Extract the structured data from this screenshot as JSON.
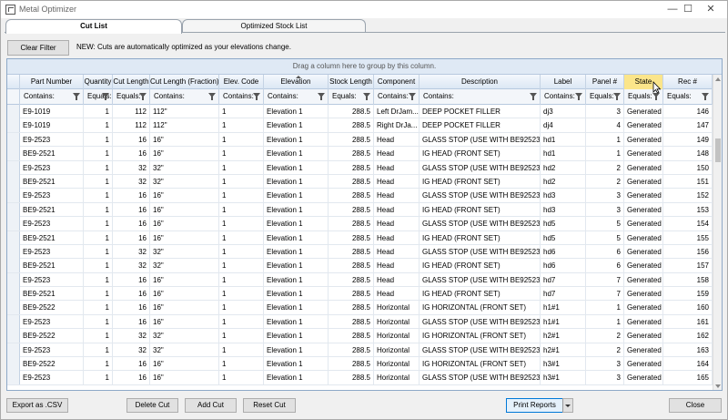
{
  "window": {
    "title": "Metal Optimizer",
    "controls": {
      "minimize": "—",
      "maximize": "☐",
      "close": "✕"
    }
  },
  "tabs": [
    {
      "label": "Cut List",
      "active": true
    },
    {
      "label": "Optimized Stock List",
      "active": false
    }
  ],
  "toolbar": {
    "clear_filter": "Clear Filter",
    "notice": "NEW: Cuts are automatically optimized as your elevations change."
  },
  "grid": {
    "group_hint": "Drag a column here to group by this column.",
    "columns": [
      {
        "key": "part",
        "label": "Part Number",
        "filter": "Contains:"
      },
      {
        "key": "qty",
        "label": "Quantity",
        "filter": "Equals:"
      },
      {
        "key": "cutlen",
        "label": "Cut Length",
        "filter": "Equals:"
      },
      {
        "key": "cutfrac",
        "label": "Cut Length (Fraction)",
        "filter": "Contains:"
      },
      {
        "key": "elevcode",
        "label": "Elev. Code",
        "filter": "Contains:"
      },
      {
        "key": "elev",
        "label": "Elevation",
        "filter": "Contains:"
      },
      {
        "key": "stock",
        "label": "Stock Length",
        "filter": "Equals:"
      },
      {
        "key": "comp",
        "label": "Component",
        "filter": "Contains:"
      },
      {
        "key": "desc",
        "label": "Description",
        "filter": "Contains:"
      },
      {
        "key": "label",
        "label": "Label",
        "filter": "Contains:"
      },
      {
        "key": "panel",
        "label": "Panel #",
        "filter": "Equals:"
      },
      {
        "key": "state",
        "label": "State",
        "filter": "Equals:"
      },
      {
        "key": "rec",
        "label": "Rec #",
        "filter": "Equals:"
      }
    ],
    "rows": [
      {
        "part": "E9-1019",
        "qty": "1",
        "cutlen": "112",
        "cutfrac": "112\"",
        "elevcode": "1",
        "elev": "Elevation 1",
        "stock": "288.5",
        "comp": "Left DrJam...",
        "desc": "DEEP POCKET FILLER",
        "label": "dj3",
        "panel": "3",
        "state": "Generated",
        "rec": "146"
      },
      {
        "part": "E9-1019",
        "qty": "1",
        "cutlen": "112",
        "cutfrac": "112\"",
        "elevcode": "1",
        "elev": "Elevation 1",
        "stock": "288.5",
        "comp": "Right DrJa...",
        "desc": "DEEP POCKET FILLER",
        "label": "dj4",
        "panel": "4",
        "state": "Generated",
        "rec": "147"
      },
      {
        "part": "E9-2523",
        "qty": "1",
        "cutlen": "16",
        "cutfrac": "16\"",
        "elevcode": "1",
        "elev": "Elevation 1",
        "stock": "288.5",
        "comp": "Head",
        "desc": "GLASS STOP (USE WITH BE92523)",
        "label": "hd1",
        "panel": "1",
        "state": "Generated",
        "rec": "149"
      },
      {
        "part": "BE9-2521",
        "qty": "1",
        "cutlen": "16",
        "cutfrac": "16\"",
        "elevcode": "1",
        "elev": "Elevation 1",
        "stock": "288.5",
        "comp": "Head",
        "desc": "IG HEAD (FRONT SET)",
        "label": "hd1",
        "panel": "1",
        "state": "Generated",
        "rec": "148"
      },
      {
        "part": "E9-2523",
        "qty": "1",
        "cutlen": "32",
        "cutfrac": "32\"",
        "elevcode": "1",
        "elev": "Elevation 1",
        "stock": "288.5",
        "comp": "Head",
        "desc": "GLASS STOP (USE WITH BE92523)",
        "label": "hd2",
        "panel": "2",
        "state": "Generated",
        "rec": "150"
      },
      {
        "part": "BE9-2521",
        "qty": "1",
        "cutlen": "32",
        "cutfrac": "32\"",
        "elevcode": "1",
        "elev": "Elevation 1",
        "stock": "288.5",
        "comp": "Head",
        "desc": "IG HEAD (FRONT SET)",
        "label": "hd2",
        "panel": "2",
        "state": "Generated",
        "rec": "151"
      },
      {
        "part": "E9-2523",
        "qty": "1",
        "cutlen": "16",
        "cutfrac": "16\"",
        "elevcode": "1",
        "elev": "Elevation 1",
        "stock": "288.5",
        "comp": "Head",
        "desc": "GLASS STOP (USE WITH BE92523)",
        "label": "hd3",
        "panel": "3",
        "state": "Generated",
        "rec": "152"
      },
      {
        "part": "BE9-2521",
        "qty": "1",
        "cutlen": "16",
        "cutfrac": "16\"",
        "elevcode": "1",
        "elev": "Elevation 1",
        "stock": "288.5",
        "comp": "Head",
        "desc": "IG HEAD (FRONT SET)",
        "label": "hd3",
        "panel": "3",
        "state": "Generated",
        "rec": "153"
      },
      {
        "part": "E9-2523",
        "qty": "1",
        "cutlen": "16",
        "cutfrac": "16\"",
        "elevcode": "1",
        "elev": "Elevation 1",
        "stock": "288.5",
        "comp": "Head",
        "desc": "GLASS STOP (USE WITH BE92523)",
        "label": "hd5",
        "panel": "5",
        "state": "Generated",
        "rec": "154"
      },
      {
        "part": "BE9-2521",
        "qty": "1",
        "cutlen": "16",
        "cutfrac": "16\"",
        "elevcode": "1",
        "elev": "Elevation 1",
        "stock": "288.5",
        "comp": "Head",
        "desc": "IG HEAD (FRONT SET)",
        "label": "hd5",
        "panel": "5",
        "state": "Generated",
        "rec": "155"
      },
      {
        "part": "E9-2523",
        "qty": "1",
        "cutlen": "32",
        "cutfrac": "32\"",
        "elevcode": "1",
        "elev": "Elevation 1",
        "stock": "288.5",
        "comp": "Head",
        "desc": "GLASS STOP (USE WITH BE92523)",
        "label": "hd6",
        "panel": "6",
        "state": "Generated",
        "rec": "156"
      },
      {
        "part": "BE9-2521",
        "qty": "1",
        "cutlen": "32",
        "cutfrac": "32\"",
        "elevcode": "1",
        "elev": "Elevation 1",
        "stock": "288.5",
        "comp": "Head",
        "desc": "IG HEAD (FRONT SET)",
        "label": "hd6",
        "panel": "6",
        "state": "Generated",
        "rec": "157"
      },
      {
        "part": "E9-2523",
        "qty": "1",
        "cutlen": "16",
        "cutfrac": "16\"",
        "elevcode": "1",
        "elev": "Elevation 1",
        "stock": "288.5",
        "comp": "Head",
        "desc": "GLASS STOP (USE WITH BE92523)",
        "label": "hd7",
        "panel": "7",
        "state": "Generated",
        "rec": "158"
      },
      {
        "part": "BE9-2521",
        "qty": "1",
        "cutlen": "16",
        "cutfrac": "16\"",
        "elevcode": "1",
        "elev": "Elevation 1",
        "stock": "288.5",
        "comp": "Head",
        "desc": "IG HEAD (FRONT SET)",
        "label": "hd7",
        "panel": "7",
        "state": "Generated",
        "rec": "159"
      },
      {
        "part": "BE9-2522",
        "qty": "1",
        "cutlen": "16",
        "cutfrac": "16\"",
        "elevcode": "1",
        "elev": "Elevation 1",
        "stock": "288.5",
        "comp": "Horizontal",
        "desc": "IG HORIZONTAL (FRONT SET)",
        "label": "h1#1",
        "panel": "1",
        "state": "Generated",
        "rec": "160"
      },
      {
        "part": "E9-2523",
        "qty": "1",
        "cutlen": "16",
        "cutfrac": "16\"",
        "elevcode": "1",
        "elev": "Elevation 1",
        "stock": "288.5",
        "comp": "Horizontal",
        "desc": "GLASS STOP (USE WITH BE92523)",
        "label": "h1#1",
        "panel": "1",
        "state": "Generated",
        "rec": "161"
      },
      {
        "part": "BE9-2522",
        "qty": "1",
        "cutlen": "32",
        "cutfrac": "32\"",
        "elevcode": "1",
        "elev": "Elevation 1",
        "stock": "288.5",
        "comp": "Horizontal",
        "desc": "IG HORIZONTAL (FRONT SET)",
        "label": "h2#1",
        "panel": "2",
        "state": "Generated",
        "rec": "162"
      },
      {
        "part": "E9-2523",
        "qty": "1",
        "cutlen": "32",
        "cutfrac": "32\"",
        "elevcode": "1",
        "elev": "Elevation 1",
        "stock": "288.5",
        "comp": "Horizontal",
        "desc": "GLASS STOP (USE WITH BE92523)",
        "label": "h2#1",
        "panel": "2",
        "state": "Generated",
        "rec": "163"
      },
      {
        "part": "BE9-2522",
        "qty": "1",
        "cutlen": "16",
        "cutfrac": "16\"",
        "elevcode": "1",
        "elev": "Elevation 1",
        "stock": "288.5",
        "comp": "Horizontal",
        "desc": "IG HORIZONTAL (FRONT SET)",
        "label": "h3#1",
        "panel": "3",
        "state": "Generated",
        "rec": "164"
      },
      {
        "part": "E9-2523",
        "qty": "1",
        "cutlen": "16",
        "cutfrac": "16\"",
        "elevcode": "1",
        "elev": "Elevation 1",
        "stock": "288.5",
        "comp": "Horizontal",
        "desc": "GLASS STOP (USE WITH BE92523)",
        "label": "h3#1",
        "panel": "3",
        "state": "Generated",
        "rec": "165"
      }
    ]
  },
  "footer": {
    "export": "Export as .CSV",
    "delete": "Delete Cut",
    "add": "Add Cut",
    "reset": "Reset Cut",
    "print": "Print Reports",
    "close": "Close"
  }
}
